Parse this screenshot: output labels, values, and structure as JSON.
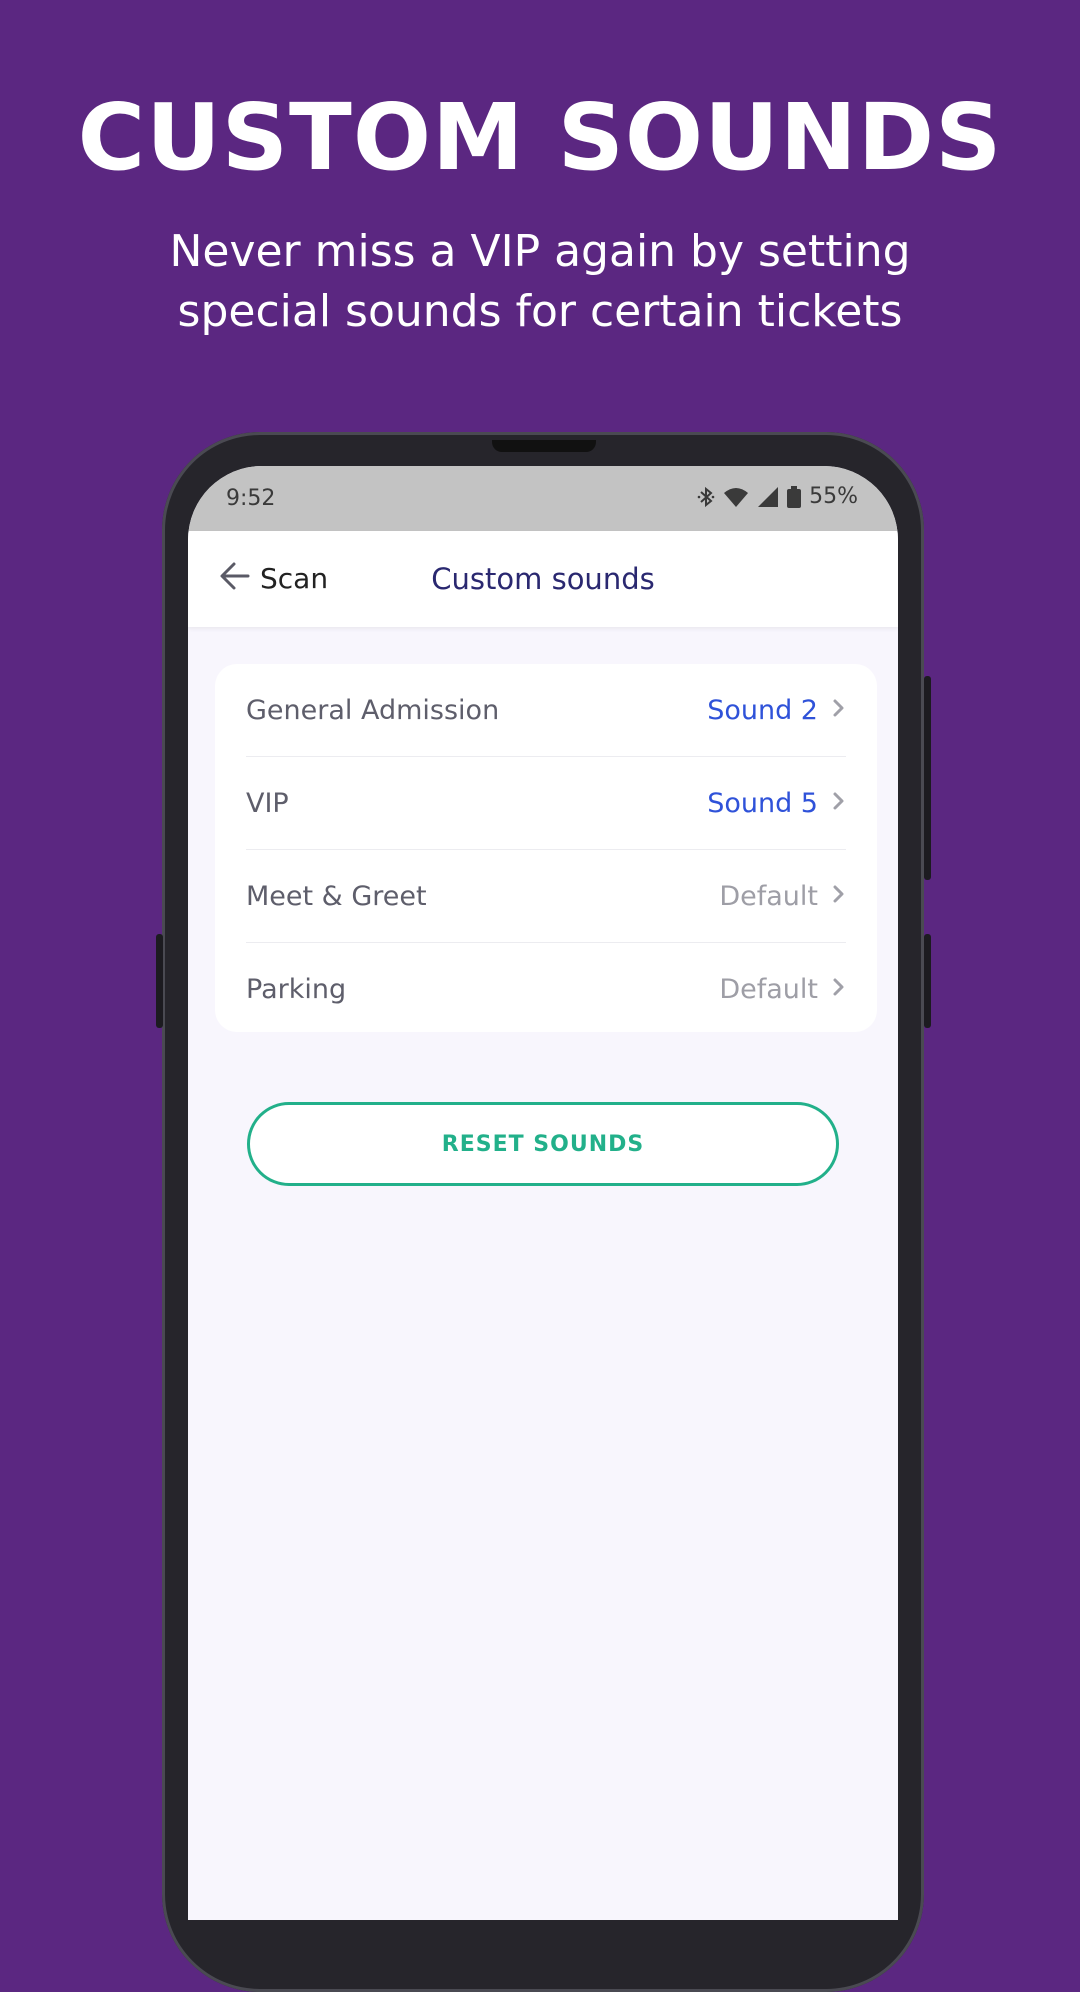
{
  "promo": {
    "headline": "CUSTOM SOUNDS",
    "subhead_line1": "Never miss a VIP again by setting",
    "subhead_line2": "special sounds for certain tickets"
  },
  "status_bar": {
    "time": "9:52",
    "battery": "55%",
    "icons": [
      "bluetooth-icon",
      "wifi-icon",
      "signal-icon",
      "battery-icon"
    ]
  },
  "nav": {
    "back_label": "Scan",
    "title": "Custom sounds"
  },
  "ticket_sounds": [
    {
      "ticket": "General Admission",
      "sound": "Sound 2",
      "state": "set"
    },
    {
      "ticket": "VIP",
      "sound": "Sound 5",
      "state": "set"
    },
    {
      "ticket": "Meet & Greet",
      "sound": "Default",
      "state": "default"
    },
    {
      "ticket": "Parking",
      "sound": "Default",
      "state": "default"
    }
  ],
  "reset_button": {
    "label": "RESET SOUNDS"
  },
  "colors": {
    "background": "#5b2781",
    "title": "#2a2870",
    "sound_set": "#2f52d9",
    "sound_default": "#9e9ea6",
    "accent": "#22b08a"
  }
}
